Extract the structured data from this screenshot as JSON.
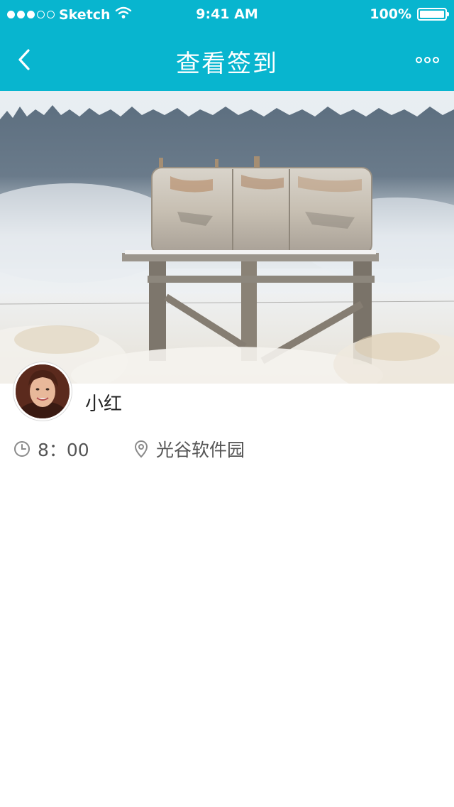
{
  "status_bar": {
    "carrier": "Sketch",
    "time": "9:41 AM",
    "battery": "100%",
    "battery_level": 1.0,
    "signal_bars_filled": 3,
    "signal_bars_total": 5,
    "icons": [
      "signal-icon",
      "wifi-icon",
      "battery-icon"
    ]
  },
  "nav": {
    "title": "查看签到",
    "back_icon": "chevron-left-icon",
    "more_icon": "more-dots-icon"
  },
  "photo": {
    "subject": "snowy field water tank photo"
  },
  "user": {
    "name": "小红",
    "avatar_icon": "avatar"
  },
  "checkin": {
    "time": "8：00",
    "location": "光谷软件园",
    "time_icon": "clock-icon",
    "location_icon": "location-pin-icon"
  },
  "colors": {
    "header_bg": "#08b5cf",
    "text_primary": "#222222",
    "text_secondary": "#555555",
    "icon_gray": "#8a8a8a"
  }
}
